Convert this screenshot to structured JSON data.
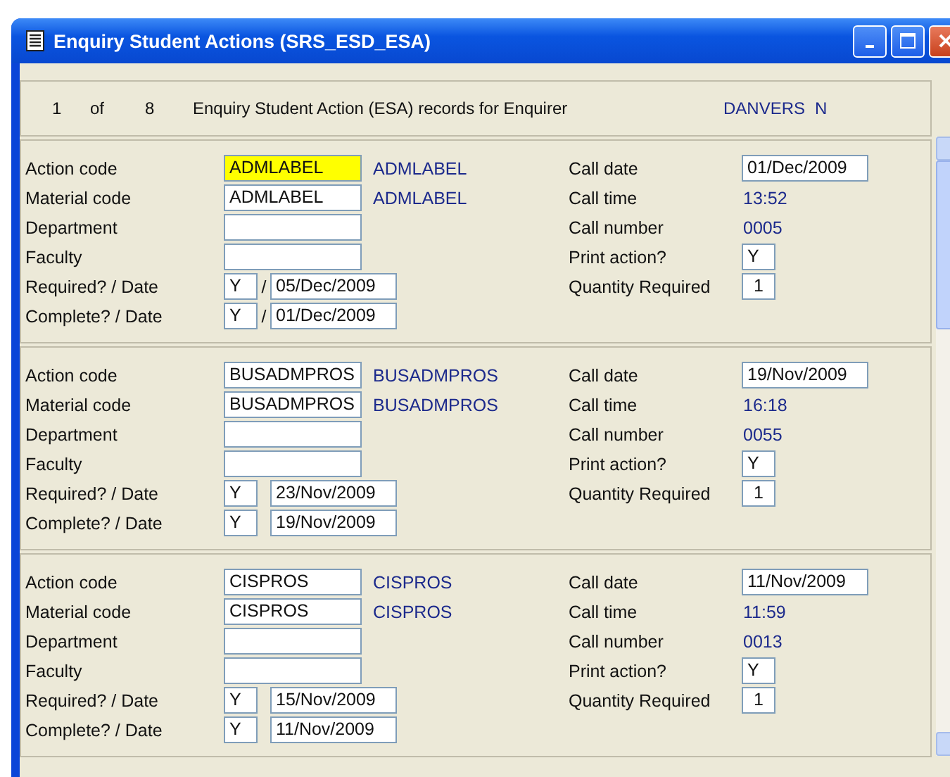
{
  "window": {
    "title": "Enquiry Student Actions (SRS_ESD_ESA)"
  },
  "header": {
    "record": "1",
    "of": "of",
    "total": "8",
    "description": "Enquiry Student Action (ESA) records for Enquirer",
    "enquirer": "DANVERS",
    "flag": "N"
  },
  "records": [
    {
      "left": [
        {
          "kind": "code",
          "label": "Action code",
          "value": "ADMLABEL",
          "description": "ADMLABEL",
          "highlighted": true
        },
        {
          "kind": "code",
          "label": "Material code",
          "value": "ADMLABEL",
          "description": "ADMLABEL",
          "highlighted": false
        },
        {
          "kind": "field",
          "label": "Department"
        },
        {
          "kind": "field",
          "label": "Faculty"
        },
        {
          "kind": "flag_date",
          "label": "Required? / Date",
          "flag": "Y",
          "separator": "/",
          "date": "05/Dec/2009"
        },
        {
          "kind": "flag_date",
          "label": "Complete? / Date",
          "flag": "Y",
          "separator": "/",
          "date": "01/Dec/2009"
        }
      ],
      "right": [
        {
          "kind": "field",
          "label": "Call date",
          "value": "01/Dec/2009"
        },
        {
          "kind": "text",
          "label": "Call time",
          "value": "13:52"
        },
        {
          "kind": "text",
          "label": "Call number",
          "value": "0005"
        },
        {
          "kind": "flag",
          "label": "Print action?",
          "value": "Y"
        },
        {
          "kind": "number",
          "label": "Quantity Required",
          "value": "1"
        }
      ]
    },
    {
      "left": [
        {
          "kind": "code",
          "label": "Action code",
          "value": "BUSADMPROS",
          "description": "BUSADMPROS",
          "highlighted": false
        },
        {
          "kind": "code",
          "label": "Material code",
          "value": "BUSADMPROS",
          "description": "BUSADMPROS",
          "highlighted": false
        },
        {
          "kind": "field",
          "label": "Department"
        },
        {
          "kind": "field",
          "label": "Faculty"
        },
        {
          "kind": "flag_date",
          "label": "Required? / Date",
          "flag": "Y",
          "date": "23/Nov/2009"
        },
        {
          "kind": "flag_date",
          "label": "Complete? / Date",
          "flag": "Y",
          "date": "19/Nov/2009"
        }
      ],
      "right": [
        {
          "kind": "field",
          "label": "Call date",
          "value": "19/Nov/2009"
        },
        {
          "kind": "text",
          "label": "Call time",
          "value": "16:18"
        },
        {
          "kind": "text",
          "label": "Call number",
          "value": "0055"
        },
        {
          "kind": "flag",
          "label": "Print action?",
          "value": "Y"
        },
        {
          "kind": "number",
          "label": "Quantity Required",
          "value": "1"
        }
      ]
    },
    {
      "left": [
        {
          "kind": "code",
          "label": "Action code",
          "value": "CISPROS",
          "description": "CISPROS",
          "highlighted": false
        },
        {
          "kind": "code",
          "label": "Material code",
          "value": "CISPROS",
          "description": "CISPROS",
          "highlighted": false
        },
        {
          "kind": "field",
          "label": "Department"
        },
        {
          "kind": "field",
          "label": "Faculty"
        },
        {
          "kind": "flag_date",
          "label": "Required? / Date",
          "flag": "Y",
          "date": "15/Nov/2009"
        },
        {
          "kind": "flag_date",
          "label": "Complete? / Date",
          "flag": "Y",
          "date": "11/Nov/2009"
        }
      ],
      "right": [
        {
          "kind": "field",
          "label": "Call date",
          "value": "11/Nov/2009"
        },
        {
          "kind": "text",
          "label": "Call time",
          "value": "11:59"
        },
        {
          "kind": "text",
          "label": "Call number",
          "value": "0013"
        },
        {
          "kind": "flag",
          "label": "Print action?",
          "value": "Y"
        },
        {
          "kind": "number",
          "label": "Quantity Required",
          "value": "1"
        }
      ]
    }
  ]
}
